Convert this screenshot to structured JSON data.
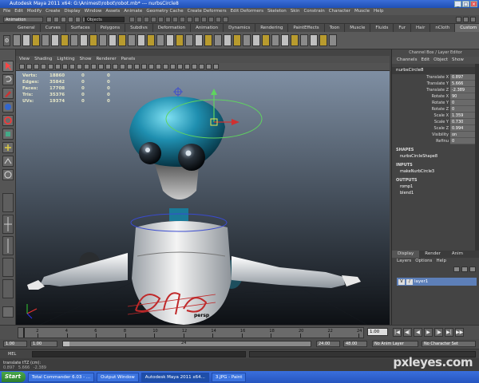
{
  "window": {
    "title": "Autodesk Maya 2011 x64: G:\\Animest\\robot\\robot.mb* --- nurbsCircle8"
  },
  "menubar": [
    "File",
    "Edit",
    "Modify",
    "Create",
    "Display",
    "Window",
    "Assets",
    "Animate",
    "Geometry Cache",
    "Create Deformers",
    "Edit Deformers",
    "Skeleton",
    "Skin",
    "Constrain",
    "Character",
    "Muscle",
    "Help"
  ],
  "status": {
    "mode": "Animation",
    "selection_field": "Objects"
  },
  "shelf_tabs": [
    "General",
    "Curves",
    "Surfaces",
    "Polygons",
    "Subdivs",
    "Deformation",
    "Animation",
    "Dynamics",
    "Rendering",
    "PaintEffects",
    "Toon",
    "Muscle",
    "Fluids",
    "Fur",
    "Hair",
    "nCloth",
    "Custom",
    "GoZBrush"
  ],
  "shelf_active": "Custom",
  "panel_menu": [
    "View",
    "Shading",
    "Lighting",
    "Show",
    "Renderer",
    "Panels"
  ],
  "hud": [
    {
      "label": "Verts:",
      "value": "18860",
      "c1": "0",
      "c2": "0"
    },
    {
      "label": "Edges:",
      "value": "35842",
      "c1": "0",
      "c2": "0"
    },
    {
      "label": "Faces:",
      "value": "17708",
      "c1": "0",
      "c2": "0"
    },
    {
      "label": "Tris:",
      "value": "35376",
      "c1": "0",
      "c2": "0"
    },
    {
      "label": "UVs:",
      "value": "19374",
      "c1": "0",
      "c2": "0"
    }
  ],
  "viewport_label": "persp",
  "channelbox": {
    "title": "Channel Box / Layer Editor",
    "menu": [
      "Channels",
      "Edit",
      "Object",
      "Show"
    ],
    "object": "nurbsCircle8",
    "attributes": [
      {
        "name": "Translate X",
        "value": "0.897"
      },
      {
        "name": "Translate Y",
        "value": "5.666"
      },
      {
        "name": "Translate Z",
        "value": "-2.389"
      },
      {
        "name": "Rotate X",
        "value": "90"
      },
      {
        "name": "Rotate Y",
        "value": "0"
      },
      {
        "name": "Rotate Z",
        "value": "0"
      },
      {
        "name": "Scale X",
        "value": "1.359"
      },
      {
        "name": "Scale Y",
        "value": "0.730"
      },
      {
        "name": "Scale Z",
        "value": "0.994"
      },
      {
        "name": "Visibility",
        "value": "on"
      },
      {
        "name": "Refinu",
        "value": "0"
      }
    ],
    "shapes_header": "SHAPES",
    "shapes": [
      "nurbsCircleShape8"
    ],
    "inputs_header": "INPUTS",
    "inputs": [
      "makeNurbCircle3"
    ],
    "outputs_header": "OUTPUTS",
    "outputs": [
      "romp1",
      "blend1"
    ]
  },
  "layer_panel": {
    "tabs": [
      "Display",
      "Render",
      "Anim"
    ],
    "active_tab": "Display",
    "menu": [
      "Layers",
      "Options",
      "Help"
    ],
    "layer": {
      "v": "V",
      "p": "/",
      "name": "layer1"
    }
  },
  "timeline": {
    "ticks": [
      "2",
      "4",
      "6",
      "8",
      "10",
      "12",
      "14",
      "16",
      "18",
      "20",
      "22",
      "24"
    ],
    "current_frame": "1.00",
    "controls": [
      "|◀",
      "◀|",
      "◀",
      "▶",
      "|▶",
      "▶|",
      "▶▶"
    ]
  },
  "range": {
    "start": "1.00",
    "playback_start": "1.00",
    "current": "24",
    "end": "24.00",
    "max": "48.00",
    "anim_layer": "No Anim Layer",
    "character_set": "No Character Set"
  },
  "command_line": {
    "label": "MEL"
  },
  "help_line": {
    "text": "translate tTZ (cm):",
    "coords": "0.897   5.666   -2.389"
  },
  "taskbar": {
    "start": "Start",
    "items": [
      "Total Commander 6.03 - ...",
      "Output Window",
      "Autodesk Maya 2011 x64...",
      "3.JPG - Paint"
    ],
    "active_index": 2
  },
  "watermark": "pxleyes.com",
  "colors": {
    "robot_teal": "#1f8fb0",
    "manipulator_green": "#5fd45f",
    "title_blue": "#2a5fcc"
  }
}
